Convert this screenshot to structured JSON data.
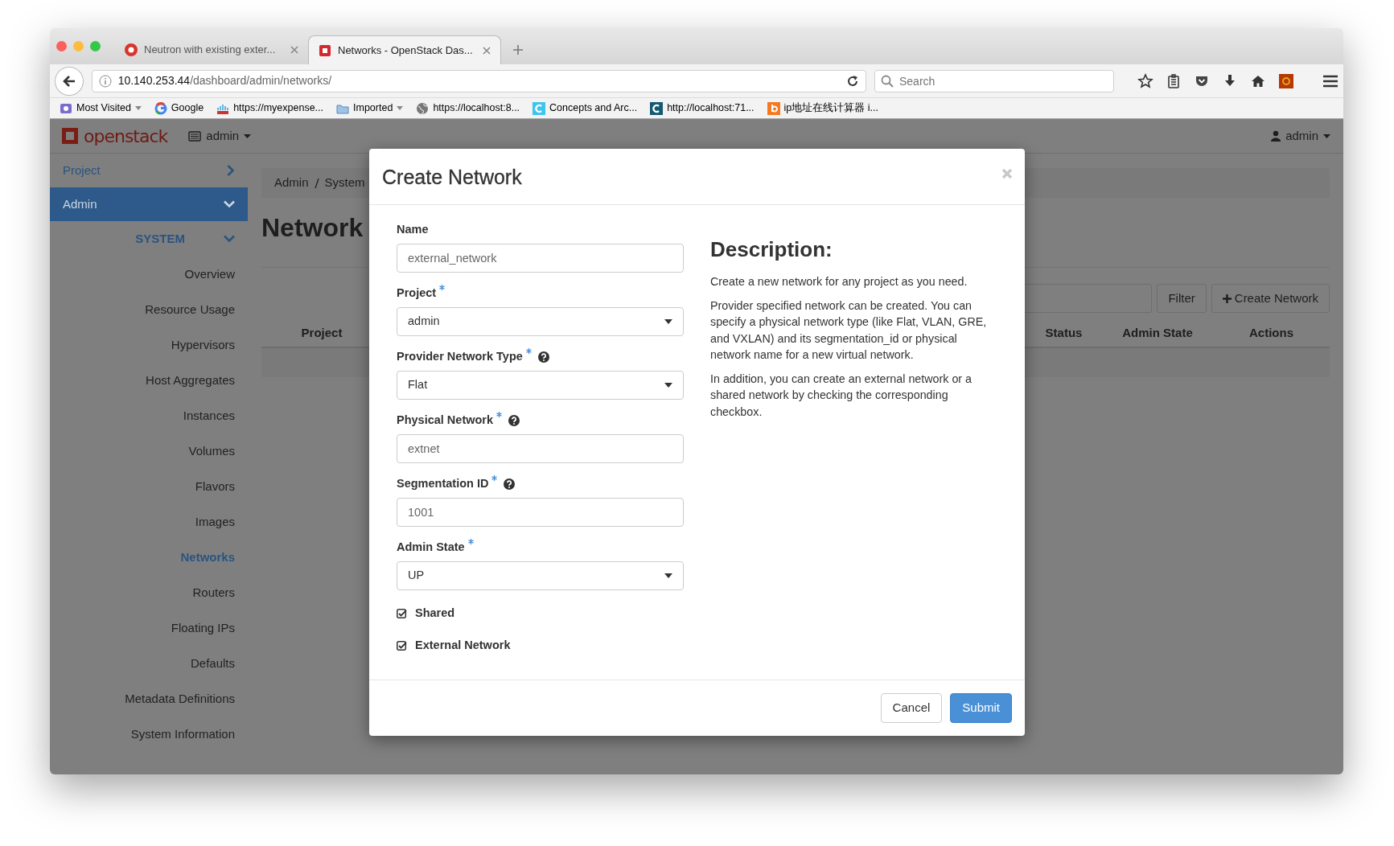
{
  "browser": {
    "tabs": [
      {
        "title": "Neutron with existing exter...",
        "kind": "rdo",
        "selected": false
      },
      {
        "title": "Networks - OpenStack Das...",
        "kind": "openstack",
        "selected": true
      }
    ],
    "address": {
      "host": "10.140.253.44",
      "path": "/dashboard/admin/networks/"
    },
    "search": {
      "placeholder": "Search"
    },
    "bookmarks": [
      {
        "label": "Most Visited",
        "kind": "launcher",
        "dropdown": true
      },
      {
        "label": "Google",
        "kind": "google",
        "dropdown": false
      },
      {
        "label": "https://myexpense...",
        "kind": "cisco",
        "dropdown": false
      },
      {
        "label": "Imported",
        "kind": "folder",
        "dropdown": true
      },
      {
        "label": "https://localhost:8...",
        "kind": "globe",
        "dropdown": false
      },
      {
        "label": "Concepts and Arc...",
        "kind": "tile-cyan",
        "dropdown": false
      },
      {
        "label": "http://localhost:71...",
        "kind": "tile-teal",
        "dropdown": false
      },
      {
        "label": "ip地址在线计算器 i...",
        "kind": "tile-orange",
        "dropdown": false
      }
    ]
  },
  "navbar": {
    "brand": "openstack",
    "project": "admin",
    "user": "admin"
  },
  "sidebar": {
    "dashboards": [
      {
        "label": "Project",
        "expanded": false,
        "selected": false
      },
      {
        "label": "Admin",
        "expanded": true,
        "selected": true,
        "children": [
          {
            "label": "SYSTEM",
            "expanded": true,
            "children": [
              {
                "label": "Overview",
                "selected": false
              },
              {
                "label": "Resource Usage",
                "selected": false
              },
              {
                "label": "Hypervisors",
                "selected": false
              },
              {
                "label": "Host Aggregates",
                "selected": false
              },
              {
                "label": "Instances",
                "selected": false
              },
              {
                "label": "Volumes",
                "selected": false
              },
              {
                "label": "Flavors",
                "selected": false
              },
              {
                "label": "Images",
                "selected": false
              },
              {
                "label": "Networks",
                "selected": true
              },
              {
                "label": "Routers",
                "selected": false
              },
              {
                "label": "Floating IPs",
                "selected": false
              },
              {
                "label": "Defaults",
                "selected": false
              },
              {
                "label": "Metadata Definitions",
                "selected": false
              },
              {
                "label": "System Information",
                "selected": false
              }
            ]
          }
        ]
      }
    ]
  },
  "page": {
    "breadcrumb": [
      "Admin",
      "System"
    ],
    "title": "Network",
    "filter_button": "Filter",
    "create_button": "Create Network",
    "columns": [
      "Project",
      "Status",
      "Admin State",
      "Actions"
    ]
  },
  "modal": {
    "title": "Create Network",
    "fields": [
      {
        "label": "Name",
        "kind": "text",
        "required": false,
        "help": false,
        "value": "external_network"
      },
      {
        "label": "Project",
        "kind": "select",
        "required": true,
        "help": false,
        "value": "admin"
      },
      {
        "label": "Provider Network Type",
        "kind": "select",
        "required": true,
        "help": true,
        "value": "Flat"
      },
      {
        "label": "Physical Network",
        "kind": "text",
        "required": true,
        "help": true,
        "value": "extnet"
      },
      {
        "label": "Segmentation ID",
        "kind": "text",
        "required": true,
        "help": true,
        "value": "1001"
      },
      {
        "label": "Admin State",
        "kind": "select",
        "required": true,
        "help": false,
        "value": "UP"
      }
    ],
    "checkboxes": [
      {
        "label": "Shared",
        "checked": true
      },
      {
        "label": "External Network",
        "checked": true
      }
    ],
    "description": {
      "title": "Description:",
      "paragraphs": [
        "Create a new network for any project as you need.",
        "Provider specified network can be created. You can specify a physical network type (like Flat, VLAN, GRE, and VXLAN) and its segmentation_id or physical network name for a new virtual network.",
        "In addition, you can create an external network or a shared network by checking the corresponding checkbox."
      ]
    },
    "buttons": [
      {
        "label": "Cancel",
        "kind": "secondary"
      },
      {
        "label": "Submit",
        "kind": "primary"
      }
    ]
  }
}
